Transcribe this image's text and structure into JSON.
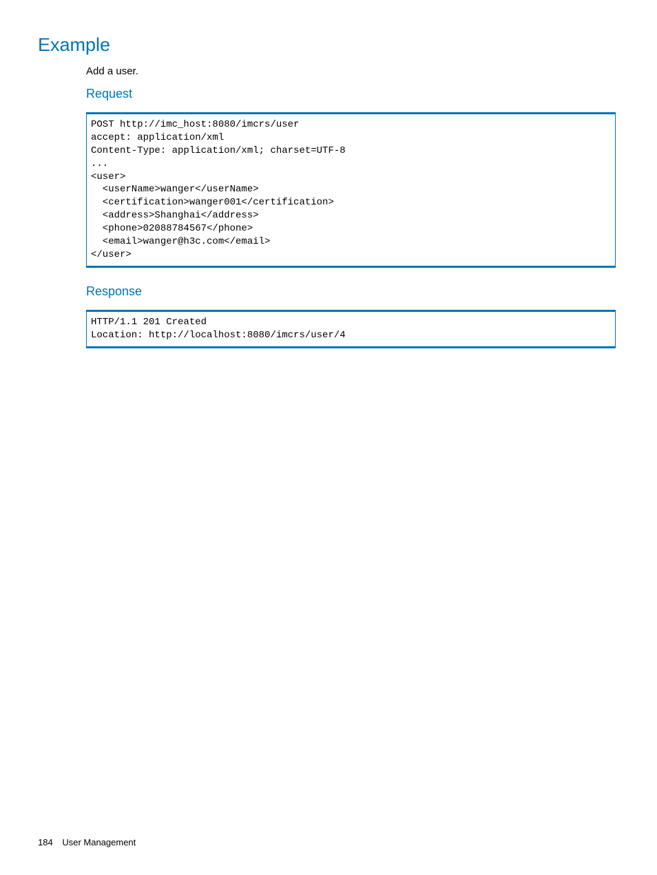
{
  "headings": {
    "example": "Example",
    "request": "Request",
    "response": "Response"
  },
  "body": {
    "intro": "Add a user."
  },
  "code": {
    "request": "POST http://imc_host:8080/imcrs/user\naccept: application/xml\nContent-Type: application/xml; charset=UTF-8\n...\n<user>\n  <userName>wanger</userName>\n  <certification>wanger001</certification>\n  <address>Shanghai</address>\n  <phone>02088784567</phone>\n  <email>wanger@h3c.com</email>\n</user>",
    "response": "HTTP/1.1 201 Created\nLocation: http://localhost:8080/imcrs/user/4"
  },
  "footer": {
    "page_number": "184",
    "section": "User Management"
  }
}
